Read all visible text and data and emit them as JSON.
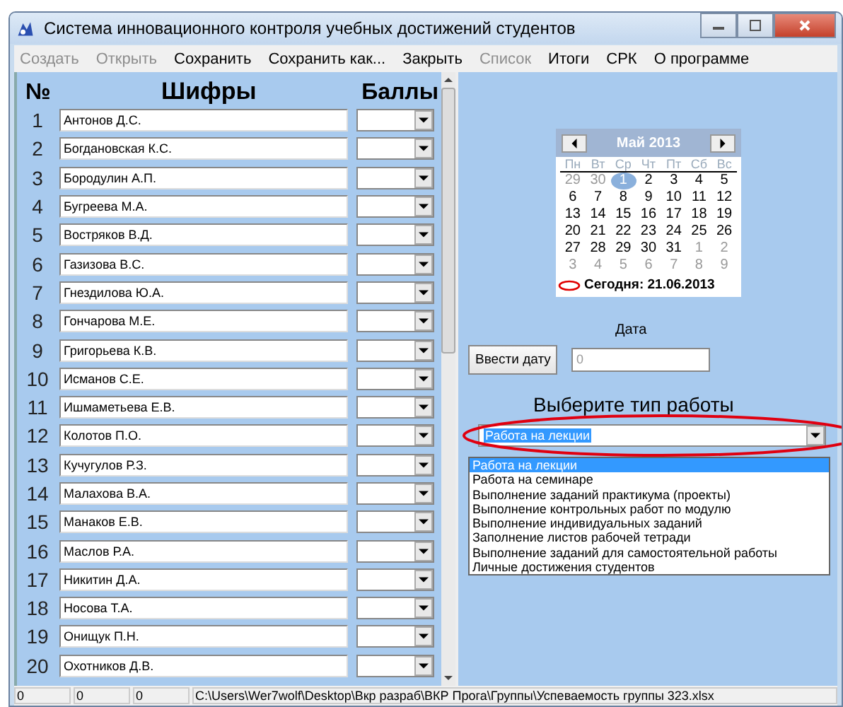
{
  "window": {
    "title": "Система инновационного контроля учебных достижений студентов"
  },
  "menu": [
    {
      "label": "Создать",
      "disabled": true
    },
    {
      "label": "Открыть",
      "disabled": true
    },
    {
      "label": "Сохранить",
      "disabled": false
    },
    {
      "label": "Сохранить как...",
      "disabled": false
    },
    {
      "label": "Закрыть",
      "disabled": false
    },
    {
      "label": "Список",
      "disabled": true
    },
    {
      "label": "Итоги",
      "disabled": false
    },
    {
      "label": "СРК",
      "disabled": false
    },
    {
      "label": "О программе",
      "disabled": false
    }
  ],
  "grid": {
    "columns": [
      "№",
      "Шифры",
      "Баллы"
    ],
    "rows": [
      {
        "number": "1",
        "name": "Антонов Д.С."
      },
      {
        "number": "2",
        "name": "Богдановская К.С."
      },
      {
        "number": "3",
        "name": "Бородулин А.П."
      },
      {
        "number": "4",
        "name": "Бугреева М.А."
      },
      {
        "number": "5",
        "name": "Востряков В.Д."
      },
      {
        "number": "6",
        "name": "Газизова В.С."
      },
      {
        "number": "7",
        "name": "Гнездилова Ю.А."
      },
      {
        "number": "8",
        "name": "Гончарова М.Е."
      },
      {
        "number": "9",
        "name": "Григорьева К.В."
      },
      {
        "number": "10",
        "name": "Исманов С.Е."
      },
      {
        "number": "11",
        "name": "Ишмаметьева Е.В."
      },
      {
        "number": "12",
        "name": "Колотов П.О."
      },
      {
        "number": "13",
        "name": "Кучугулов Р.З."
      },
      {
        "number": "14",
        "name": "Малахова В.А."
      },
      {
        "number": "15",
        "name": "Манаков Е.В."
      },
      {
        "number": "16",
        "name": "Маслов Р.А."
      },
      {
        "number": "17",
        "name": "Никитин Д.А."
      },
      {
        "number": "18",
        "name": "Носова Т.А."
      },
      {
        "number": "19",
        "name": "Онищук П.Н."
      },
      {
        "number": "20",
        "name": "Охотников Д.В."
      }
    ]
  },
  "calendar": {
    "month": "Май 2013",
    "weekdays": [
      "Пн",
      "Вт",
      "Ср",
      "Чт",
      "Пт",
      "Сб",
      "Вс"
    ],
    "days": [
      {
        "label": "29",
        "other_month": true,
        "selected": false
      },
      {
        "label": "30",
        "other_month": true,
        "selected": false
      },
      {
        "label": "1",
        "other_month": false,
        "selected": true
      },
      {
        "label": "2",
        "other_month": false,
        "selected": false
      },
      {
        "label": "3",
        "other_month": false,
        "selected": false
      },
      {
        "label": "4",
        "other_month": false,
        "selected": false
      },
      {
        "label": "5",
        "other_month": false,
        "selected": false
      },
      {
        "label": "6",
        "other_month": false,
        "selected": false
      },
      {
        "label": "7",
        "other_month": false,
        "selected": false
      },
      {
        "label": "8",
        "other_month": false,
        "selected": false
      },
      {
        "label": "9",
        "other_month": false,
        "selected": false
      },
      {
        "label": "10",
        "other_month": false,
        "selected": false
      },
      {
        "label": "11",
        "other_month": false,
        "selected": false
      },
      {
        "label": "12",
        "other_month": false,
        "selected": false
      },
      {
        "label": "13",
        "other_month": false,
        "selected": false
      },
      {
        "label": "14",
        "other_month": false,
        "selected": false
      },
      {
        "label": "15",
        "other_month": false,
        "selected": false
      },
      {
        "label": "16",
        "other_month": false,
        "selected": false
      },
      {
        "label": "17",
        "other_month": false,
        "selected": false
      },
      {
        "label": "18",
        "other_month": false,
        "selected": false
      },
      {
        "label": "19",
        "other_month": false,
        "selected": false
      },
      {
        "label": "20",
        "other_month": false,
        "selected": false
      },
      {
        "label": "21",
        "other_month": false,
        "selected": false
      },
      {
        "label": "22",
        "other_month": false,
        "selected": false
      },
      {
        "label": "23",
        "other_month": false,
        "selected": false
      },
      {
        "label": "24",
        "other_month": false,
        "selected": false
      },
      {
        "label": "25",
        "other_month": false,
        "selected": false
      },
      {
        "label": "26",
        "other_month": false,
        "selected": false
      },
      {
        "label": "27",
        "other_month": false,
        "selected": false
      },
      {
        "label": "28",
        "other_month": false,
        "selected": false
      },
      {
        "label": "29",
        "other_month": false,
        "selected": false
      },
      {
        "label": "30",
        "other_month": false,
        "selected": false
      },
      {
        "label": "31",
        "other_month": false,
        "selected": false
      },
      {
        "label": "1",
        "other_month": true,
        "selected": false
      },
      {
        "label": "2",
        "other_month": true,
        "selected": false
      },
      {
        "label": "3",
        "other_month": true,
        "selected": false
      },
      {
        "label": "4",
        "other_month": true,
        "selected": false
      },
      {
        "label": "5",
        "other_month": true,
        "selected": false
      },
      {
        "label": "6",
        "other_month": true,
        "selected": false
      },
      {
        "label": "7",
        "other_month": true,
        "selected": false
      },
      {
        "label": "8",
        "other_month": true,
        "selected": false
      },
      {
        "label": "9",
        "other_month": true,
        "selected": false
      }
    ],
    "today": "Сегодня: 21.06.2013"
  },
  "date": {
    "label": "Дата",
    "button": "Ввести дату",
    "value": "0"
  },
  "work_type": {
    "heading": "Выберите тип работы",
    "value": "Работа на лекции",
    "options": [
      {
        "label": "Работа на лекции",
        "selected": true
      },
      {
        "label": "Работа на семинаре",
        "selected": false
      },
      {
        "label": "Выполнение заданий практикума (проекты)",
        "selected": false
      },
      {
        "label": "Выполнение контрольных работ по модулю",
        "selected": false
      },
      {
        "label": "Выполнение индивидуальных заданий",
        "selected": false
      },
      {
        "label": "Заполнение листов рабочей тетради",
        "selected": false
      },
      {
        "label": "Выполнение заданий для самостоятельной работы",
        "selected": false
      },
      {
        "label": "Личные достижения студентов",
        "selected": false
      }
    ]
  },
  "status_bar": [
    "0",
    "0",
    "0",
    "C:\\Users\\Wer7wolf\\Desktop\\Вкр разраб\\ВКР Прога\\Группы\\Успеваемость группы 323.xlsx"
  ]
}
